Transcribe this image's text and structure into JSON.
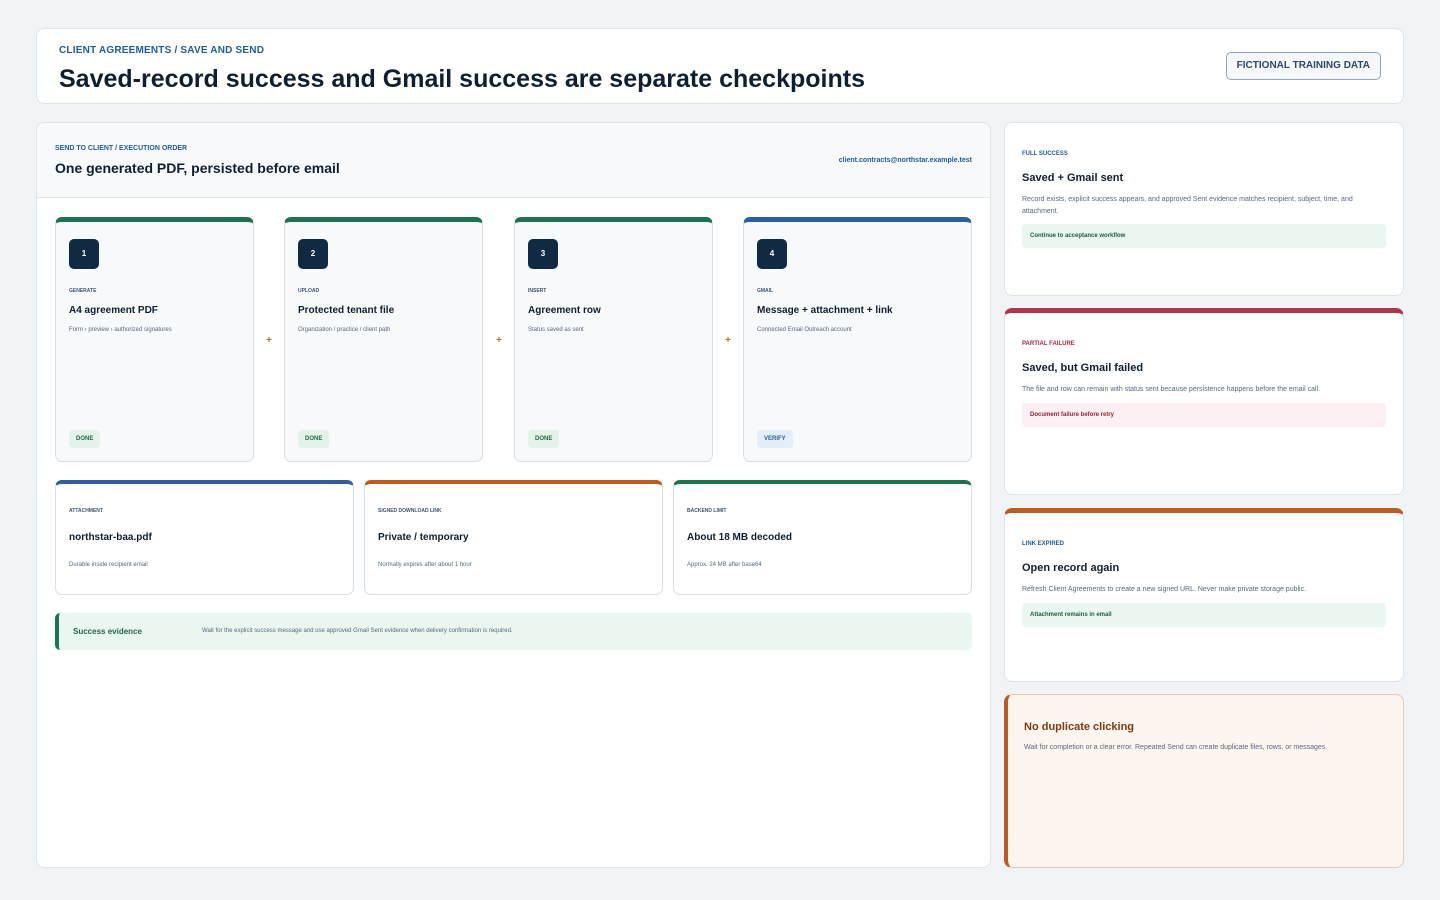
{
  "header": {
    "breadcrumb": "CLIENT AGREEMENTS / SAVE AND SEND",
    "title": "Saved-record success and Gmail success are separate checkpoints",
    "badge": "FICTIONAL TRAINING DATA"
  },
  "panel": {
    "eyebrow": "SEND TO CLIENT / EXECUTION ORDER",
    "title": "One generated PDF, persisted before email",
    "email": "client.contracts@northstar.example.test"
  },
  "steps": [
    {
      "num": "1",
      "eyebrow": "GENERATE",
      "title": "A4 agreement PDF",
      "desc": "Form › preview › authorized signatures",
      "status": "DONE"
    },
    {
      "num": "2",
      "eyebrow": "UPLOAD",
      "title": "Protected tenant file",
      "desc": "Organization / practice / client path",
      "status": "DONE"
    },
    {
      "num": "3",
      "eyebrow": "INSERT",
      "title": "Agreement row",
      "desc": "Status saved as sent",
      "status": "DONE"
    },
    {
      "num": "4",
      "eyebrow": "GMAIL",
      "title": "Message + attachment + link",
      "desc": "Connected Email Outreach account",
      "status": "VERIFY"
    }
  ],
  "connector": "+",
  "info_cards": [
    {
      "eyebrow": "ATTACHMENT",
      "title": "northstar-baa.pdf",
      "desc": "Durable inside recipient email"
    },
    {
      "eyebrow": "SIGNED DOWNLOAD LINK",
      "title": "Private / temporary",
      "desc": "Normally expires after about 1 hour"
    },
    {
      "eyebrow": "BACKEND LIMIT",
      "title": "About 18 MB decoded",
      "desc": "Approx. 24 MB after base64"
    }
  ],
  "evidence": {
    "label": "Success evidence",
    "text": "Wait for the explicit success message and use approved Gmail Sent evidence when delivery confirmation is required."
  },
  "side_cards": [
    {
      "eyebrow": "FULL SUCCESS",
      "title": "Saved + Gmail sent",
      "desc": "Record exists, explicit success appears, and approved Sent evidence matches recipient, subject, time, and attachment.",
      "pill": "Continue to acceptance workflow"
    },
    {
      "eyebrow": "PARTIAL FAILURE",
      "title": "Saved, but Gmail failed",
      "desc": "The file and row can remain with status sent because persistence happens before the email call.",
      "pill": "Document failure before retry"
    },
    {
      "eyebrow": "LINK EXPIRED",
      "title": "Open record again",
      "desc": "Refresh Client Agreements to create a new signed URL. Never make private storage public.",
      "pill": "Attachment remains in email"
    }
  ],
  "warning": {
    "title": "No duplicate clicking",
    "desc": "Wait for completion or a clear error. Repeated Send can create duplicate files, rows, or messages."
  },
  "colors": {
    "primary_navy": "#102a43",
    "accent_blue": "#2b5fa0",
    "success_green": "#1d7450",
    "failure_red": "#b3344a",
    "warning_orange": "#c15a1f"
  }
}
